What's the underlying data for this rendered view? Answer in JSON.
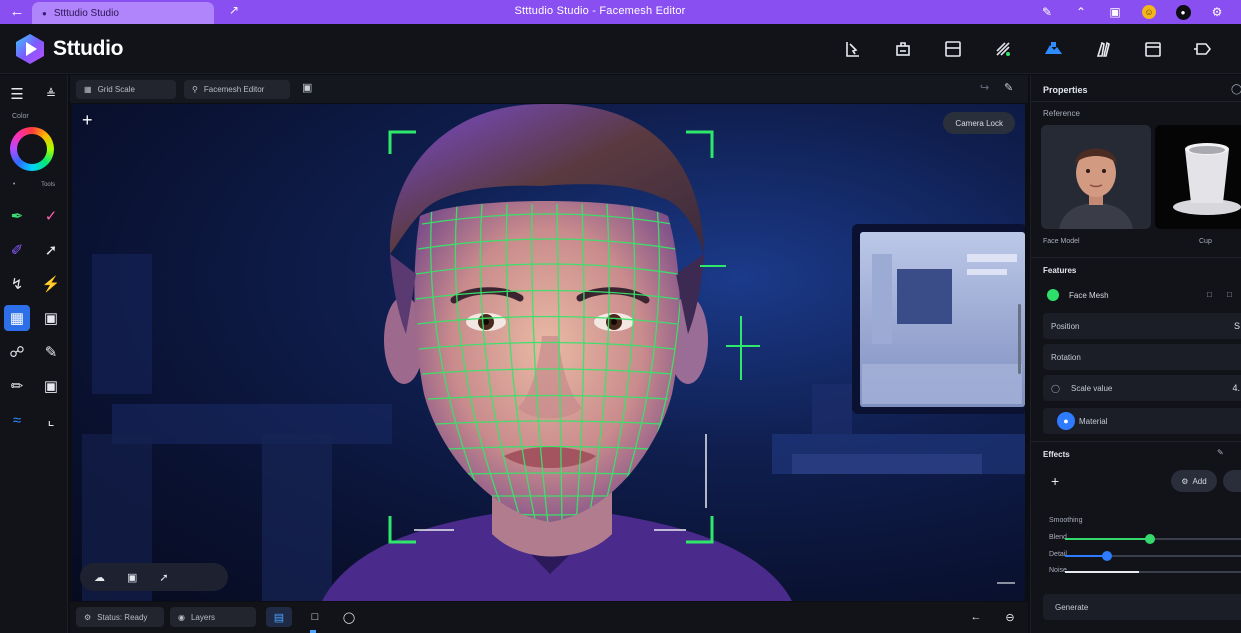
{
  "window": {
    "tab_title": "Stttudio Studio",
    "title": "Stttudio Studio - Facemesh Editor",
    "top_icons": [
      "pen-icon",
      "up-arrow-icon",
      "store-icon",
      "emoji-icon",
      "account-icon",
      "settings-icon"
    ]
  },
  "app": {
    "brand": "Sttudio"
  },
  "toolbar": {
    "tools": [
      "select-tool-icon",
      "transform-tool-icon",
      "frame-tool-icon",
      "mesh-tool-icon",
      "paint-tool-icon",
      "brush-tool-icon",
      "layout-tool-icon",
      "shape-tool-icon"
    ],
    "active": "paint-tool-icon"
  },
  "leftbar": {
    "section_label": "Color",
    "tool_label": "Tools"
  },
  "viewport": {
    "search_a": "Grid Scale",
    "search_b": "Facemesh Editor",
    "camera_pill": "Camera Lock",
    "accent": "#2ee86b"
  },
  "statusbar": {
    "field_a": "Status: Ready",
    "field_b": "Layers"
  },
  "panel": {
    "header": "Properties",
    "assets_title": "Reference",
    "asset_a_caption": "Face Model",
    "asset_b_caption": "Cup",
    "layers_title": "Features",
    "layer_active": "Face Mesh",
    "rows": [
      {
        "label": "Position",
        "value": "S"
      },
      {
        "label": "Rotation",
        "value": ""
      },
      {
        "label": "Scale value",
        "value": "4."
      },
      {
        "label": "Material",
        "value": ""
      }
    ],
    "effects_title": "Effects",
    "add_button": "Add",
    "sliders_title": "Smoothing",
    "slider_labels": [
      "Blend",
      "Detail",
      "Noise"
    ],
    "slider_values": [
      0.48,
      0.24,
      0.42
    ],
    "slider_colors": [
      "#35d96b",
      "#2f7bff",
      "#e8eaf0"
    ],
    "footer_button": "Generate"
  }
}
